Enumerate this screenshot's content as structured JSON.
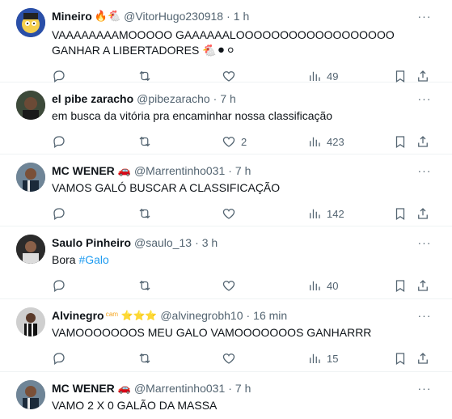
{
  "tweets": [
    {
      "name": "Mineiro",
      "badges": "🔥🐔",
      "handle": "@VitorHugo230918",
      "time": "1 h",
      "text": "VAAAAAAAAMOOOOO GAAAAAALOOOOOOOOOOOOOOOOOO GANHAR A LIBERTADORES 🐔⚫⚪",
      "replies": "",
      "retweets": "",
      "likes": "",
      "views": "49"
    },
    {
      "name": "el pibe zaracho",
      "badges": "",
      "handle": "@pibezaracho",
      "time": "7 h",
      "text": "em busca da vitória pra encaminhar nossa classificação",
      "replies": "",
      "retweets": "",
      "likes": "2",
      "views": "423"
    },
    {
      "name": "MC WENER",
      "badges": "🚗",
      "handle": "@Marrentinho031",
      "time": "7 h",
      "text": "VAMOS GALÓ BUSCAR A CLASSIFICAÇÃO",
      "replies": "",
      "retweets": "",
      "likes": "",
      "views": "142"
    },
    {
      "name": "Saulo Pinheiro",
      "badges": "",
      "handle": "@saulo_13",
      "time": "3 h",
      "text": "Bora ",
      "hashtag": "#Galo",
      "replies": "",
      "retweets": "",
      "likes": "",
      "views": "40"
    },
    {
      "name": "Alvinegro",
      "badges": "ᶜᵃᵐ ⭐⭐⭐",
      "handle": "@alvinegrobh10",
      "time": "16 min",
      "text": "VAMOOOOOOOS MEU GALO VAMOOOOOOOS GANHARRR",
      "replies": "",
      "retweets": "",
      "likes": "",
      "views": "15"
    },
    {
      "name": "MC WENER",
      "badges": "🚗",
      "handle": "@Marrentinho031",
      "time": "7 h",
      "text": "VAMO 2 X 0 GALÃO DA MASSA"
    }
  ],
  "more_label": "···",
  "colors": {
    "link": "#1d9bf0",
    "muted": "#536471",
    "text": "#0f1419"
  }
}
